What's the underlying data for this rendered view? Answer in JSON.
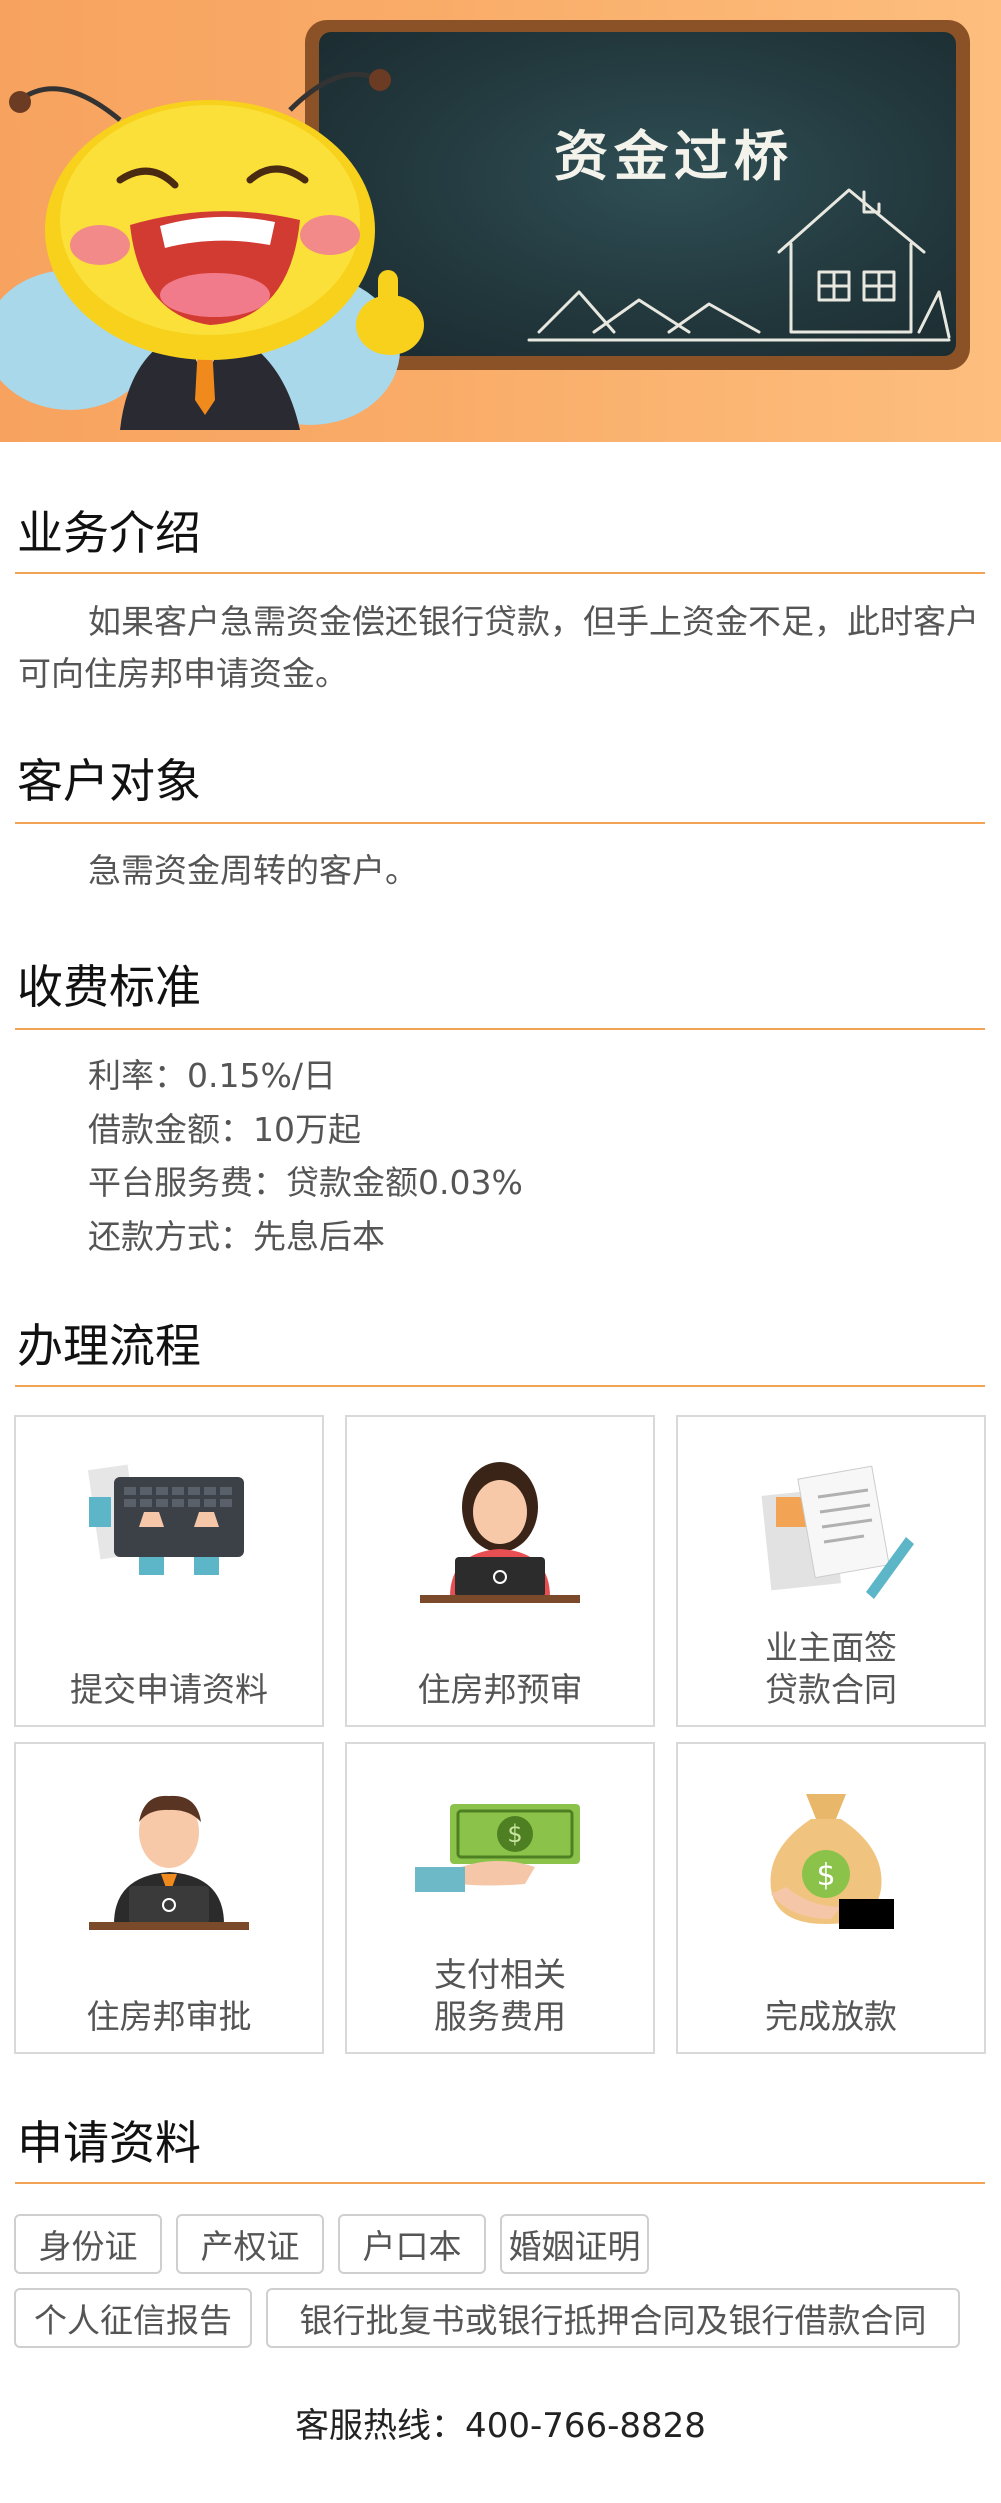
{
  "banner": {
    "title": "资金过桥"
  },
  "intro": {
    "title": "业务介绍",
    "text": "如果客户急需资金偿还银行贷款，但手上资金不足，此时客户可向住房邦申请资金。"
  },
  "target": {
    "title": "客户对象",
    "text": "急需资金周转的客户。"
  },
  "fees": {
    "title": "收费标准",
    "items": [
      "利率：0.15%/日",
      "借款金额：10万起",
      "平台服务费：贷款金额0.03%",
      "还款方式：先息后本"
    ]
  },
  "process": {
    "title": "办理流程",
    "steps": [
      {
        "line1": "提交申请资料",
        "line2": "",
        "icon": "laptop-typing-icon"
      },
      {
        "line1": "住房邦预审",
        "line2": "",
        "icon": "woman-laptop-icon"
      },
      {
        "line1": "业主面签",
        "line2": "贷款合同",
        "icon": "documents-pen-icon"
      },
      {
        "line1": "住房邦审批",
        "line2": "",
        "icon": "man-laptop-icon"
      },
      {
        "line1": "支付相关",
        "line2": "服务费用",
        "icon": "cash-hand-icon"
      },
      {
        "line1": "完成放款",
        "line2": "",
        "icon": "money-bag-icon"
      }
    ]
  },
  "materials": {
    "title": "申请资料",
    "tags": [
      "身份证",
      "产权证",
      "户口本",
      "婚姻证明",
      "个人征信报告",
      "银行批复书或银行抵押合同及银行借款合同"
    ]
  },
  "footer": {
    "hotline": "客服热线：400-766-8828"
  },
  "colors": {
    "accent": "#f2a454",
    "banner": "#f9ab67",
    "board": "#22383d"
  }
}
